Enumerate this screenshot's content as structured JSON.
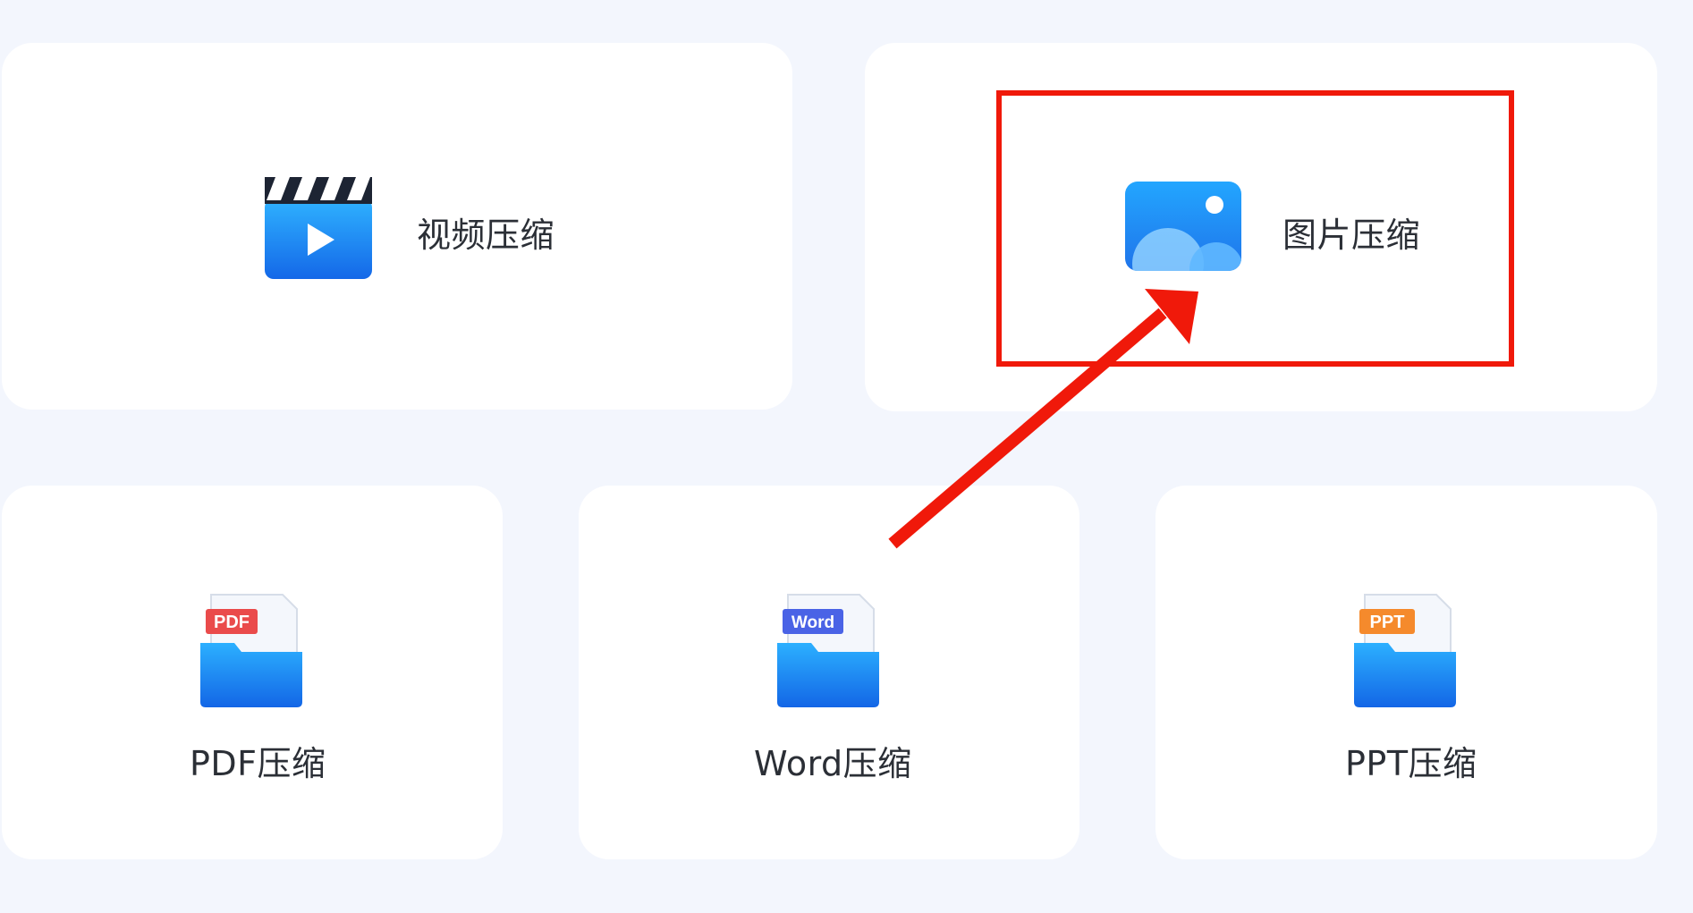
{
  "cards": {
    "video": {
      "label": "视频压缩",
      "icon": "video-clapper-icon"
    },
    "image": {
      "label": "图片压缩",
      "icon": "image-icon"
    },
    "pdf": {
      "label": "PDF压缩",
      "icon": "pdf-folder-icon",
      "badge": "PDF"
    },
    "word": {
      "label": "Word压缩",
      "icon": "word-folder-icon",
      "badge": "Word"
    },
    "ppt": {
      "label": "PPT压缩",
      "icon": "ppt-folder-icon",
      "badge": "PPT"
    }
  },
  "colors": {
    "background": "#f3f6fd",
    "card": "#ffffff",
    "icon_blue": "#1f8ff0",
    "pdf_badge": "#ea4b4b",
    "word_badge": "#4a63e6",
    "ppt_badge": "#f58a2c",
    "annotation_red": "#f0190a"
  }
}
